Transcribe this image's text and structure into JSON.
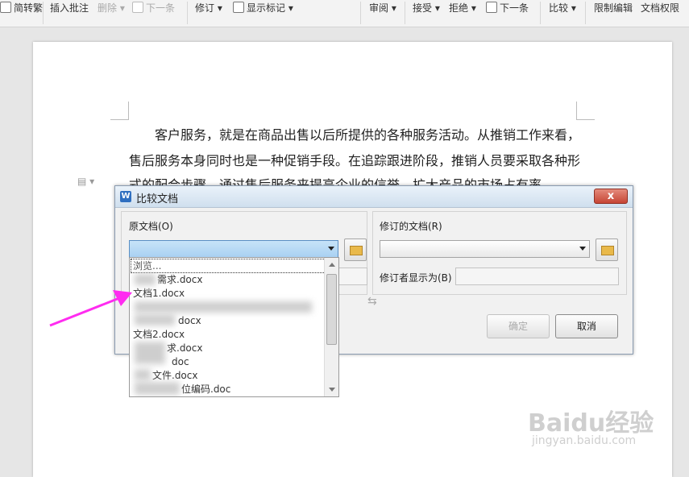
{
  "ribbon": {
    "simp_trad": "简转繁",
    "insert_comment": "插入批注",
    "delete": "删除",
    "next_prev": "下一条",
    "track_changes": "修订",
    "show_markup": "显示标记",
    "review": "审阅",
    "accept": "接受",
    "reject": "拒绝",
    "next": "下一条",
    "compare": "比较",
    "restrict_edit": "限制编辑",
    "doc_permission": "文档权限"
  },
  "document": {
    "lines": [
      "客户服务，就是在商品出售以后所提供的各种服务活动。从推销工作来看，",
      "售后服务本身同时也是一种促销手段。在追踪跟进阶段，推销人员要采取各种形",
      "式的配合步骤，通过售后服务来提高企业的信誉，扩大产品的市场占有率，"
    ]
  },
  "dialog": {
    "title": "比较文档",
    "close": "x",
    "original_label": "原文档(O)",
    "revised_label": "修订的文档(R)",
    "reviser_label": "修订者显示为(B)",
    "ok": "确定",
    "cancel": "取消"
  },
  "dropdown": {
    "browse": "浏览...",
    "items": [
      "需求.docx",
      "文档1.docx",
      "docx",
      "文档2.docx",
      "求.docx",
      "doc",
      "文件.docx",
      "位编码.doc"
    ]
  },
  "watermark": {
    "brand": "Baidu经验",
    "url": "jingyan.baidu.com"
  },
  "colors": {
    "annotation_arrow": "#ff2cf0",
    "dialog_close": "#c64535"
  }
}
